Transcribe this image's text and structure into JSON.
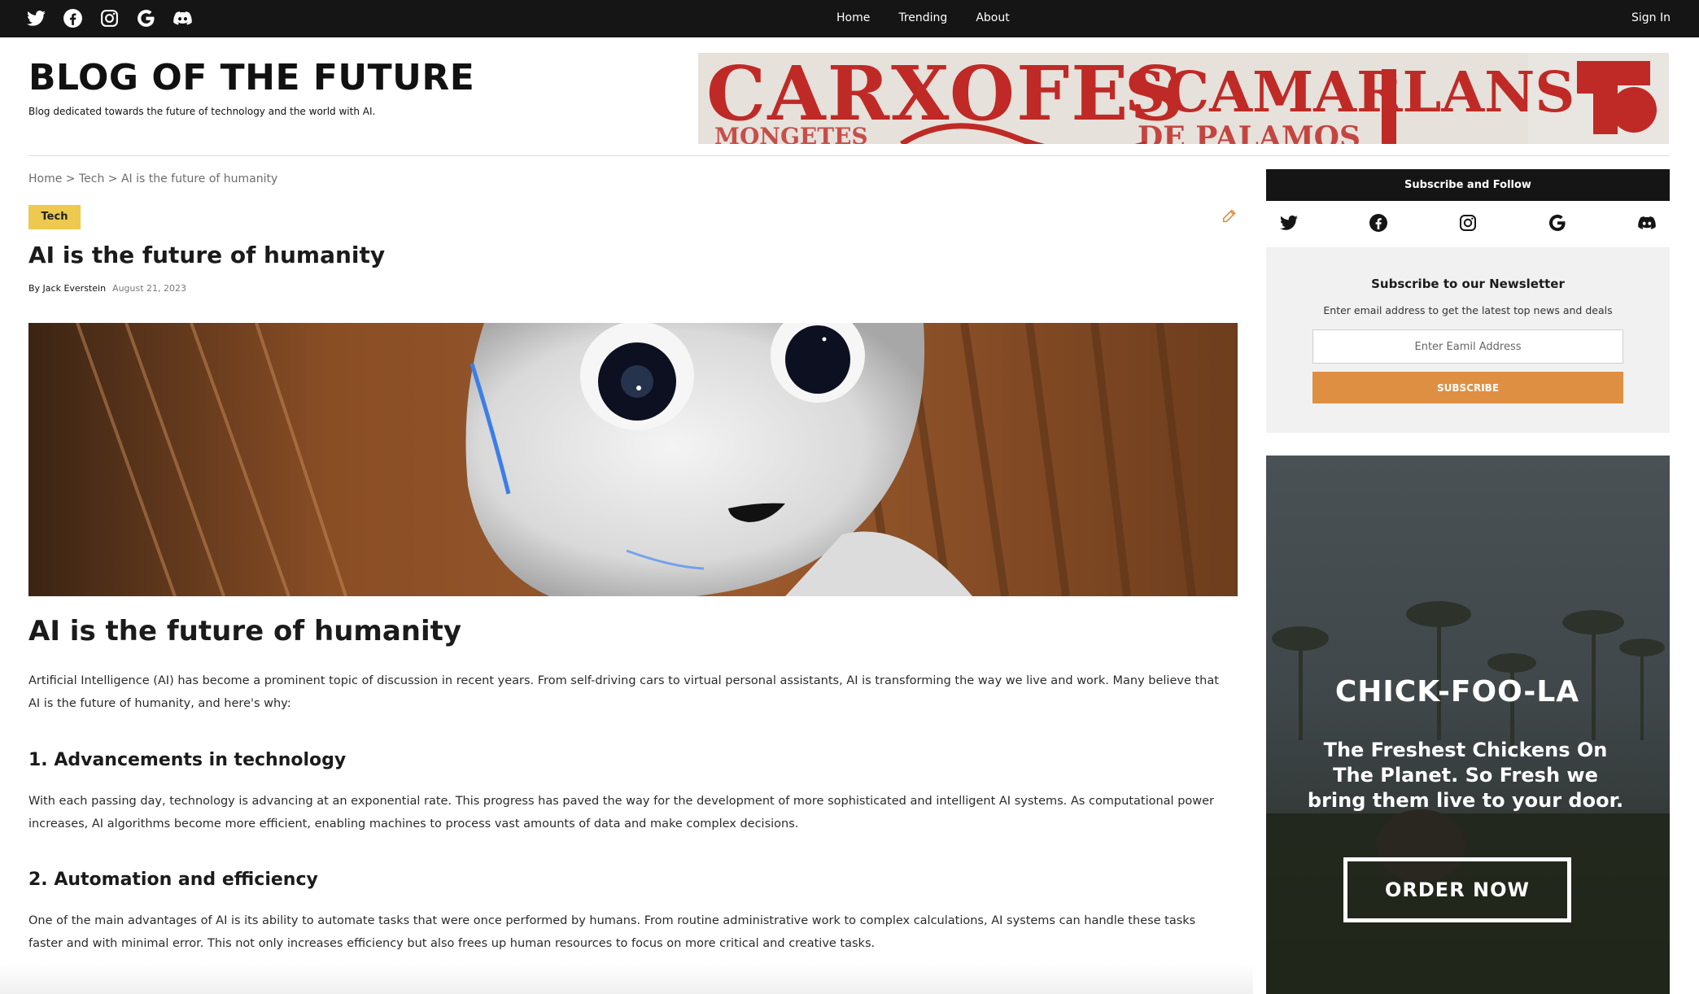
{
  "topbar": {
    "social_icons": [
      "twitter-icon",
      "facebook-icon",
      "instagram-icon",
      "google-icon",
      "discord-icon"
    ],
    "nav": [
      "Home",
      "Trending",
      "About"
    ],
    "sign_in": "Sign In"
  },
  "header": {
    "title": "BLOG OF THE FUTURE",
    "tagline": "Blog dedicated towards the future of technology and the world with AI.",
    "banner_ad": {
      "words": [
        "CARXOFES",
        "SCAMARLANS"
      ],
      "sub_words": [
        "MONGETES",
        "DE PALAMOS"
      ]
    }
  },
  "breadcrumb": "Home > Tech > AI is the future of humanity",
  "post": {
    "category": "Tech",
    "title": "AI is the future of humanity",
    "author": "By Jack Everstein",
    "date": "August 21, 2023",
    "heading": "AI is the future of humanity",
    "intro": "Artificial Intelligence (AI) has become a prominent topic of discussion in recent years. From self-driving cars to virtual personal assistants, AI is transforming the way we live and work. Many believe that AI is the future of humanity, and here's why:",
    "sections": [
      {
        "heading": "1. Advancements in technology",
        "body": "With each passing day, technology is advancing at an exponential rate. This progress has paved the way for the development of more sophisticated and intelligent AI systems. As computational power increases, AI algorithms become more efficient, enabling machines to process vast amounts of data and make complex decisions."
      },
      {
        "heading": "2. Automation and efficiency",
        "body": "One of the main advantages of AI is its ability to automate tasks that were once performed by humans. From routine administrative work to complex calculations, AI systems can handle these tasks faster and with minimal error. This not only increases efficiency but also frees up human resources to focus on more critical and creative tasks."
      }
    ]
  },
  "sidebar": {
    "follow_title": "Subscribe and Follow",
    "follow_icons": [
      "twitter-icon",
      "facebook-icon",
      "instagram-icon",
      "google-icon",
      "discord-icon"
    ],
    "newsletter": {
      "title": "Subscribe to our Newsletter",
      "description": "Enter email address to get the latest top news and deals",
      "placeholder": "Enter Eamil Address",
      "button": "SUBSCRIBE"
    },
    "ad": {
      "brand": "CHICK-FOO-LA",
      "copy": "The Freshest Chickens On The Planet. So Fresh we bring them live to your door.",
      "cta": "ORDER NOW"
    }
  },
  "colors": {
    "topbar": "#151515",
    "tag": "#eec94f",
    "subscribe": "#df8f41",
    "edit": "#df8f41"
  }
}
